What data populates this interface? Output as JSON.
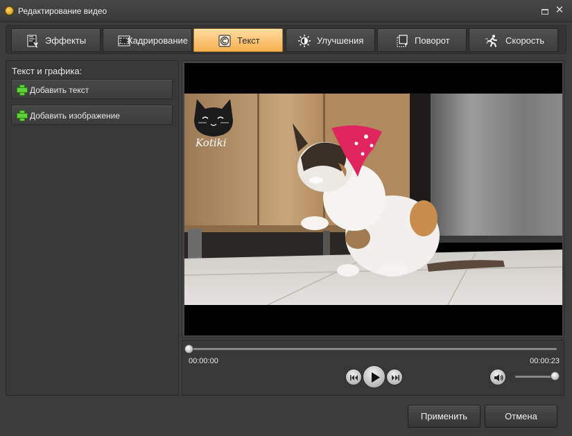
{
  "window": {
    "title": "Редактирование видео",
    "close_glyph": "✕"
  },
  "tabs": [
    {
      "label": "Эффекты",
      "icon": "effects-icon",
      "active": false
    },
    {
      "label": "Кадрирование",
      "icon": "crop-icon",
      "active": false
    },
    {
      "label": "Текст",
      "icon": "text-icon",
      "active": true
    },
    {
      "label": "Улучшения",
      "icon": "brightness-icon",
      "active": false
    },
    {
      "label": "Поворот",
      "icon": "rotate-icon",
      "active": false
    },
    {
      "label": "Скорость",
      "icon": "runner-icon",
      "active": false
    }
  ],
  "left_panel": {
    "title": "Текст и графика:",
    "add_text_label": "Добавить текст",
    "add_image_label": "Добавить изображение"
  },
  "preview": {
    "watermark_text": "Kotiki"
  },
  "player": {
    "time_current": "00:00:00",
    "time_total": "00:00:23",
    "progress_fraction": 0.0,
    "volume_fraction": 1.0
  },
  "footer": {
    "apply_label": "Применить",
    "cancel_label": "Отмена"
  },
  "colors": {
    "active_tab": "#f6b04e",
    "add_icon": "#5ed13a",
    "bandana": "#e0245e"
  }
}
